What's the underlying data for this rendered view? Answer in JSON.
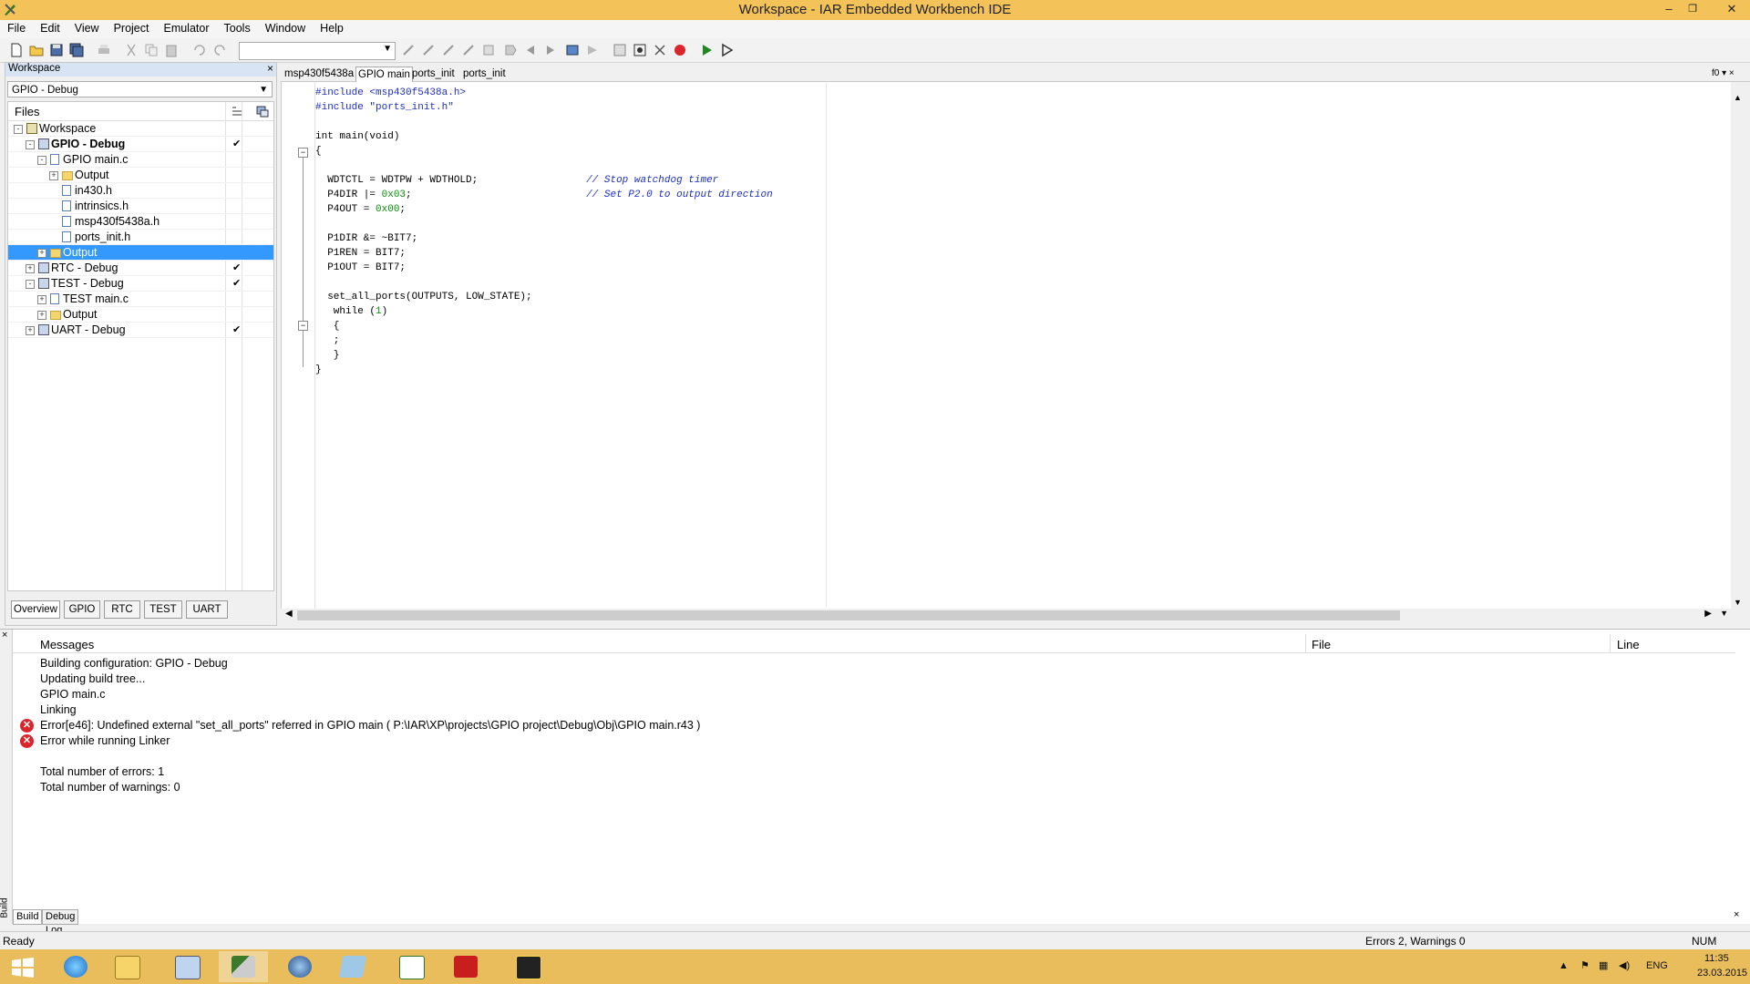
{
  "window": {
    "title": "Workspace - IAR Embedded Workbench IDE",
    "controls": {
      "minimize": "–",
      "restore": "❐",
      "close": "✕"
    }
  },
  "menu": [
    "File",
    "Edit",
    "View",
    "Project",
    "Emulator",
    "Tools",
    "Window",
    "Help"
  ],
  "toolbar": {
    "combo_value": ""
  },
  "workspace": {
    "header": "Workspace",
    "close": "×",
    "config": "GPIO - Debug",
    "files_header": "Files",
    "tree": [
      {
        "label": "Workspace",
        "level": 0,
        "icon": "workspace-icon",
        "expand": "-",
        "bold": false,
        "check": ""
      },
      {
        "label": "GPIO - Debug",
        "level": 1,
        "icon": "project-icon",
        "expand": "-",
        "bold": true,
        "check": "✔"
      },
      {
        "label": "GPIO main.c",
        "level": 2,
        "icon": "file-icon",
        "expand": "-",
        "bold": false,
        "check": ""
      },
      {
        "label": "Output",
        "level": 3,
        "icon": "folder-icon",
        "expand": "+",
        "bold": false,
        "check": ""
      },
      {
        "label": "in430.h",
        "level": 3,
        "icon": "file-icon",
        "expand": "",
        "bold": false,
        "check": ""
      },
      {
        "label": "intrinsics.h",
        "level": 3,
        "icon": "file-icon",
        "expand": "",
        "bold": false,
        "check": ""
      },
      {
        "label": "msp430f5438a.h",
        "level": 3,
        "icon": "file-icon",
        "expand": "",
        "bold": false,
        "check": ""
      },
      {
        "label": "ports_init.h",
        "level": 3,
        "icon": "file-icon",
        "expand": "",
        "bold": false,
        "check": ""
      },
      {
        "label": "Output",
        "level": 2,
        "icon": "folder-icon",
        "expand": "+",
        "bold": false,
        "check": "",
        "selected": true
      },
      {
        "label": "RTC - Debug",
        "level": 1,
        "icon": "project-icon",
        "expand": "+",
        "bold": false,
        "check": "✔"
      },
      {
        "label": "TEST - Debug",
        "level": 1,
        "icon": "project-icon",
        "expand": "-",
        "bold": false,
        "check": "✔"
      },
      {
        "label": "TEST main.c",
        "level": 2,
        "icon": "file-icon",
        "expand": "+",
        "bold": false,
        "check": ""
      },
      {
        "label": "Output",
        "level": 2,
        "icon": "folder-icon",
        "expand": "+",
        "bold": false,
        "check": ""
      },
      {
        "label": "UART - Debug",
        "level": 1,
        "icon": "project-icon",
        "expand": "+",
        "bold": false,
        "check": "✔"
      }
    ],
    "tabs": [
      "Overview",
      "GPIO",
      "RTC",
      "TEST",
      "UART"
    ],
    "active_tab": "Overview"
  },
  "editor": {
    "tabs": [
      "msp430f5438a",
      "GPIO main",
      "ports_init",
      "ports_init"
    ],
    "active_tab": "GPIO main",
    "tab_right_label": "f0 ▾ ×",
    "lines": [
      [
        [
          "pp",
          "#include <msp430f5438a.h>"
        ]
      ],
      [
        [
          "pp",
          "#include \"ports_init.h\""
        ]
      ],
      [],
      [
        [
          "kw",
          "int main(void)"
        ]
      ],
      [
        [
          "kw",
          "{"
        ]
      ],
      [],
      [
        [
          "kw",
          "  WDTCTL = WDTPW + WDTHOLD;                  "
        ],
        [
          "cm",
          "// Stop watchdog timer"
        ]
      ],
      [
        [
          "kw",
          "  P4DIR |= "
        ],
        [
          "num",
          "0x03"
        ],
        [
          "kw",
          ";                             "
        ],
        [
          "cm",
          "// Set P2.0 to output direction"
        ]
      ],
      [
        [
          "kw",
          "  P4OUT = "
        ],
        [
          "num",
          "0x00"
        ],
        [
          "kw",
          ";"
        ]
      ],
      [],
      [
        [
          "kw",
          "  P1DIR &= ~BIT7;"
        ]
      ],
      [
        [
          "kw",
          "  P1REN = BIT7;"
        ]
      ],
      [
        [
          "kw",
          "  P1OUT = BIT7;"
        ]
      ],
      [],
      [
        [
          "kw",
          "  set_all_ports(OUTPUTS, LOW_STATE);"
        ]
      ],
      [
        [
          "kw",
          "   while ("
        ],
        [
          "num",
          "1"
        ],
        [
          "kw",
          ")"
        ]
      ],
      [
        [
          "kw",
          "   {"
        ]
      ],
      [
        [
          "kw",
          "   ;"
        ]
      ],
      [
        [
          "kw",
          "   }"
        ]
      ],
      [
        [
          "kw",
          "}"
        ]
      ]
    ]
  },
  "messages": {
    "headers": {
      "messages": "Messages",
      "file": "File",
      "line": "Line"
    },
    "lines": [
      {
        "text": "Building configuration: GPIO - Debug",
        "error": false
      },
      {
        "text": "Updating build tree...",
        "error": false
      },
      {
        "text": "GPIO main.c",
        "error": false
      },
      {
        "text": "Linking",
        "error": false
      },
      {
        "text": "Error[e46]: Undefined external \"set_all_ports\" referred in GPIO main ( P:\\IAR\\XP\\projects\\GPIO project\\Debug\\Obj\\GPIO main.r43 )",
        "error": true
      },
      {
        "text": "Error while running Linker",
        "error": true
      },
      {
        "text": "",
        "error": false
      },
      {
        "text": "Total number of errors: 1",
        "error": false
      },
      {
        "text": "Total number of warnings: 0",
        "error": false
      }
    ],
    "side_label": "Build",
    "tabs": [
      "Build",
      "Debug Log"
    ],
    "active_tab": "Build"
  },
  "status": {
    "left": "Ready",
    "middle": "Errors 2, Warnings 0",
    "right": "NUM"
  },
  "taskbar": {
    "apps": [
      "start-icon",
      "internet-explorer-icon",
      "file-explorer-icon",
      "calculator-icon",
      "iar-workbench-icon",
      "thunderbird-icon",
      "notes-icon",
      "chart-app-icon",
      "acrobat-icon",
      "debugger-icon"
    ],
    "language": "ENG",
    "time": "11:35",
    "date": "23.03.2015"
  },
  "colors": {
    "titlebar": "#f3c35a",
    "taskbar": "#e9bd5c",
    "selection": "#3399ff",
    "error": "#d9252b",
    "preprocessor": "#1e2fbf",
    "number": "#0a8f0a"
  }
}
